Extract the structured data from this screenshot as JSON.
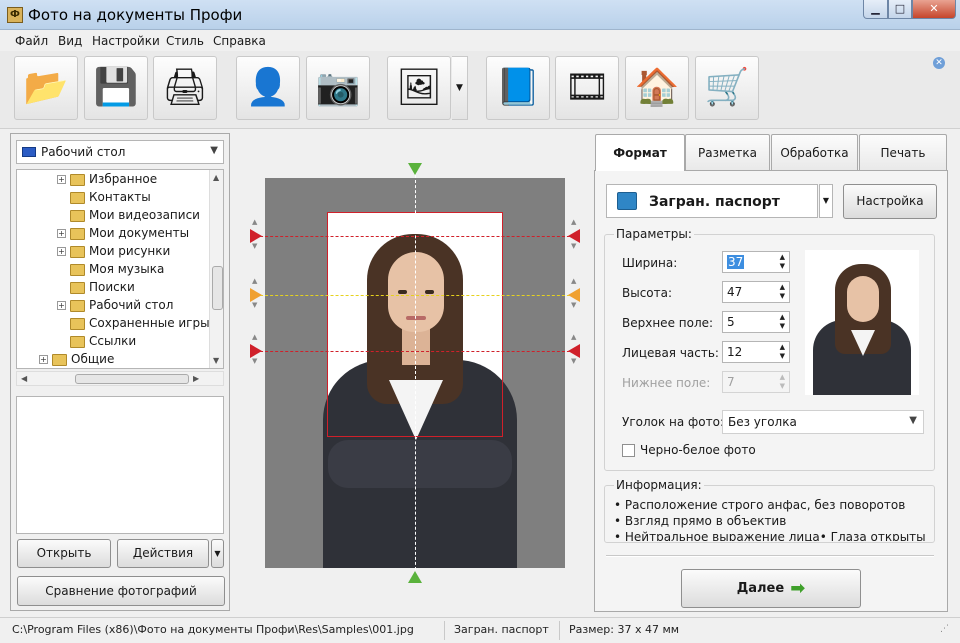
{
  "window": {
    "title": "Фото на документы Профи",
    "app_icon": "camera-app-icon"
  },
  "menu": [
    "Файл",
    "Вид",
    "Настройки",
    "Стиль",
    "Справка"
  ],
  "toolbar": {
    "buttons": [
      {
        "name": "open-folder-button",
        "icon": "📂"
      },
      {
        "name": "save-button",
        "icon": "💾"
      },
      {
        "name": "print-button",
        "icon": "🖨"
      },
      {
        "name": "person-search-button",
        "icon": "👤"
      },
      {
        "name": "camera-button",
        "icon": "📷"
      },
      {
        "name": "image-zoom-button",
        "icon": "🖼"
      },
      {
        "name": "help-book-button",
        "icon": "📘"
      },
      {
        "name": "video-reel-button",
        "icon": "🎞"
      },
      {
        "name": "home-button",
        "icon": "🏠"
      },
      {
        "name": "shop-cart-button",
        "icon": "🛒"
      }
    ]
  },
  "left_panel": {
    "location": "Рабочий стол",
    "tree": [
      {
        "label": "Избранное",
        "expandable": true
      },
      {
        "label": "Контакты",
        "expandable": false
      },
      {
        "label": "Мои видеозаписи",
        "expandable": false
      },
      {
        "label": "Мои документы",
        "expandable": true
      },
      {
        "label": "Мои рисунки",
        "expandable": true
      },
      {
        "label": "Моя музыка",
        "expandable": false
      },
      {
        "label": "Поиски",
        "expandable": false
      },
      {
        "label": "Рабочий стол",
        "expandable": true
      },
      {
        "label": "Сохраненные игры",
        "expandable": false
      },
      {
        "label": "Ссылки",
        "expandable": false
      },
      {
        "label": "Общие",
        "expandable": true
      }
    ],
    "open_label": "Открыть",
    "actions_label": "Действия",
    "compare_label": "Сравнение фотографий"
  },
  "tabs": [
    "Формат",
    "Разметка",
    "Обработка",
    "Печать"
  ],
  "format": {
    "document": "Загран. паспорт",
    "settings_label": "Настройка",
    "params_title": "Параметры:",
    "params": [
      {
        "label": "Ширина:",
        "value": "37",
        "enabled": true
      },
      {
        "label": "Высота:",
        "value": "47",
        "enabled": true
      },
      {
        "label": "Верхнее поле:",
        "value": "5",
        "enabled": true
      },
      {
        "label": "Лицевая часть:",
        "value": "12",
        "enabled": true
      },
      {
        "label": "Нижнее поле:",
        "value": "7",
        "enabled": false
      }
    ],
    "corner_label": "Уголок на фото:",
    "corner_value": "Без уголка",
    "bw_label": "Черно-белое фото",
    "bw_checked": false,
    "info_title": "Информация:",
    "info_lines": [
      "•  Расположение строго анфас, без поворотов",
      "•  Взгляд прямо в объектив",
      "•  Нейтральное выражение лица•  Глаза открыты"
    ],
    "next_label": "Далее"
  },
  "status": {
    "path": "C:\\Program Files (x86)\\Фото на документы Профи\\Res\\Samples\\001.jpg",
    "format": "Загран. паспорт",
    "size": "Размер: 37 x 47 мм"
  },
  "colors": {
    "guide_red": "#d0202a",
    "guide_yellow": "#e6d21e",
    "marker_green": "#5ab23c",
    "marker_orange": "#f0a030"
  }
}
